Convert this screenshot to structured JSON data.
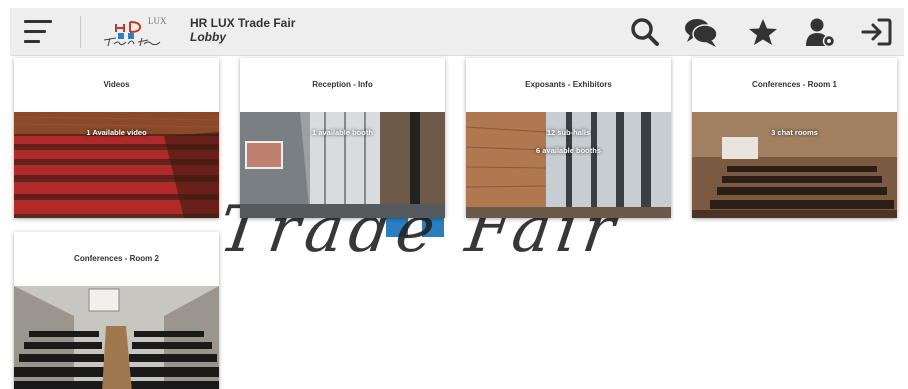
{
  "header": {
    "title": "HR LUX Trade Fair",
    "subtitle": "Lobby",
    "logo_text": "LUX",
    "icons": [
      "search-icon",
      "chat-icon",
      "star-icon",
      "user-settings-icon",
      "logout-icon"
    ]
  },
  "watermark": {
    "text": "Trade Fair"
  },
  "cards": [
    {
      "title": "Videos",
      "info": [
        "1 Available video"
      ]
    },
    {
      "title": "Reception - Info",
      "info": [
        "1 available booth"
      ]
    },
    {
      "title": "Exposants - Exhibitors",
      "info": [
        "12 sub-halls",
        "6 available booths"
      ]
    },
    {
      "title": "Conferences - Room 1",
      "info": [
        "3 chat rooms"
      ]
    },
    {
      "title": "Conferences - Room 2",
      "info": []
    }
  ],
  "colors": {
    "header_bg": "#eeeeee",
    "icon": "#333333",
    "logo_red": "#c0392b",
    "logo_blue": "#2a7fc0"
  }
}
